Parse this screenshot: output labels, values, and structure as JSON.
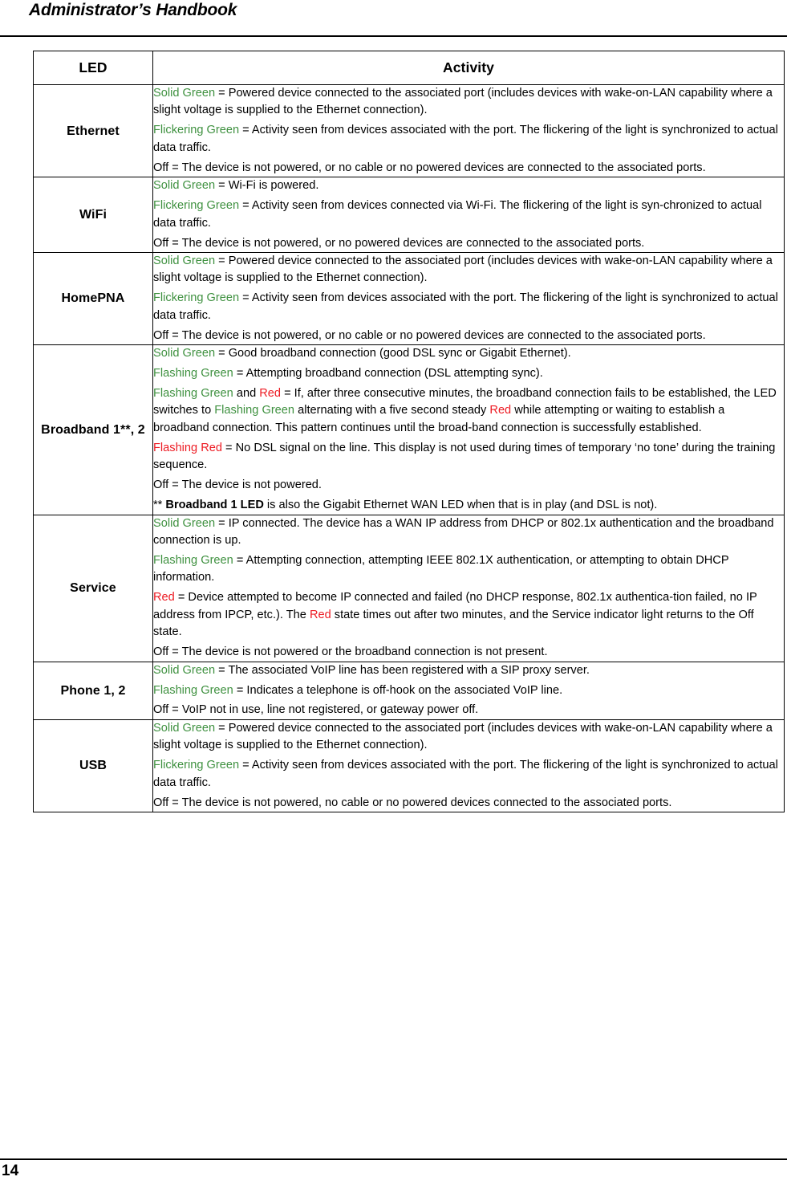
{
  "header": {
    "title": "Administrator’s Handbook"
  },
  "footer": {
    "page_number": "14"
  },
  "colors": {
    "green": "#3f9140",
    "red": "#ed1b23",
    "text": "#000000",
    "rule": "#000000",
    "background": "#ffffff"
  },
  "table": {
    "columns": [
      {
        "key": "led",
        "label": "LED"
      },
      {
        "key": "activity",
        "label": "Activity"
      }
    ],
    "rows": [
      {
        "led": "Ethernet",
        "paragraphs": [
          [
            {
              "t": "Solid Green",
              "c": "green"
            },
            {
              "t": " = Powered device connected to the associated port (includes devices with wake-on-LAN capability where a slight voltage is supplied to the Ethernet connection)."
            }
          ],
          [
            {
              "t": "Flickering Green",
              "c": "green"
            },
            {
              "t": " = Activity seen from devices associated with the port. The flickering of the light is synchronized to actual data traffic."
            }
          ],
          [
            {
              "t": "Off = The device is not powered, or no cable or no powered devices are connected to the associated ports."
            }
          ]
        ]
      },
      {
        "led": "WiFi",
        "paragraphs": [
          [
            {
              "t": "Solid Green",
              "c": "green"
            },
            {
              "t": " = Wi-Fi is powered."
            }
          ],
          [
            {
              "t": "Flickering Green",
              "c": "green"
            },
            {
              "t": " = Activity seen from devices connected via Wi-Fi. The flickering of the light is syn-chronized to actual data traffic."
            }
          ],
          [
            {
              "t": "Off = The device is not powered, or no powered devices are connected to the associated ports."
            }
          ]
        ]
      },
      {
        "led": "HomePNA",
        "paragraphs": [
          [
            {
              "t": "Solid Green",
              "c": "green"
            },
            {
              "t": " = Powered device connected to the associated port (includes devices with wake-on-LAN capability where a slight voltage is supplied to the Ethernet connection)."
            }
          ],
          [
            {
              "t": "Flickering Green",
              "c": "green"
            },
            {
              "t": " = Activity seen from devices associated with the port. The flickering of the light is synchronized to actual data traffic."
            }
          ],
          [
            {
              "t": "Off = The device is not powered, or no cable or no powered devices are connected to the associated ports."
            }
          ]
        ]
      },
      {
        "led": "Broadband 1**, 2",
        "paragraphs": [
          [
            {
              "t": "Solid Green",
              "c": "green"
            },
            {
              "t": " = Good broadband connection (good DSL sync or Gigabit Ethernet)."
            }
          ],
          [
            {
              "t": "Flashing Green",
              "c": "green"
            },
            {
              "t": " = Attempting broadband connection (DSL attempting sync)."
            }
          ],
          [
            {
              "t": "Flashing Green",
              "c": "green"
            },
            {
              "t": " and "
            },
            {
              "t": "Red",
              "c": "red"
            },
            {
              "t": " = If, after three consecutive minutes, the broadband connection fails to be established, the LED switches to "
            },
            {
              "t": "Flashing Green",
              "c": "green"
            },
            {
              "t": " alternating with a five second steady "
            },
            {
              "t": "Red",
              "c": "red"
            },
            {
              "t": " while attempting or waiting to establish a broadband connection. This pattern continues until the broad-band connection is successfully established."
            }
          ],
          [
            {
              "t": "Flashing Red",
              "c": "red"
            },
            {
              "t": " = No DSL signal on the line. This display is not used during times of temporary ‘no tone’ during the training sequence."
            }
          ],
          [
            {
              "t": "Off = The device is not powered."
            }
          ],
          [
            {
              "t": "** "
            },
            {
              "t": "Broadband 1 LED",
              "b": true
            },
            {
              "t": " is also the Gigabit Ethernet WAN LED when that is in play (and DSL is not)."
            }
          ]
        ]
      },
      {
        "led": "Service",
        "paragraphs": [
          [
            {
              "t": "Solid Green",
              "c": "green"
            },
            {
              "t": " = IP connected. The device has a WAN IP address from DHCP or 802.1x authentication and the broadband connection is up."
            }
          ],
          [
            {
              "t": "Flashing Green",
              "c": "green"
            },
            {
              "t": " = Attempting connection, attempting IEEE 802.1X authentication, or attempting to obtain DHCP information."
            }
          ],
          [
            {
              "t": "Red",
              "c": "red"
            },
            {
              "t": " = Device attempted to become IP connected and failed (no DHCP response, 802.1x authentica-tion failed, no IP address from IPCP, etc.). The "
            },
            {
              "t": "Red",
              "c": "red"
            },
            {
              "t": " state times out after two minutes, and the Service indicator light returns to the Off state."
            }
          ],
          [
            {
              "t": "Off = The device is not powered or the broadband connection is not present."
            }
          ]
        ]
      },
      {
        "led": "Phone 1, 2",
        "paragraphs": [
          [
            {
              "t": "Solid Green",
              "c": "green"
            },
            {
              "t": " = The associated VoIP line has been registered with a SIP proxy server."
            }
          ],
          [
            {
              "t": "Flashing Green",
              "c": "green"
            },
            {
              "t": " = Indicates a telephone is off-hook on the associated VoIP line."
            }
          ],
          [
            {
              "t": "Off = VoIP not in use, line not registered, or gateway power off."
            }
          ]
        ]
      },
      {
        "led": "USB",
        "paragraphs": [
          [
            {
              "t": "Solid Green",
              "c": "green"
            },
            {
              "t": " = Powered device connected to the associated port (includes devices with wake-on-LAN capability where a slight voltage is supplied to the Ethernet connection)."
            }
          ],
          [
            {
              "t": "Flickering Green",
              "c": "green"
            },
            {
              "t": " = Activity seen from devices associated with the port. The flickering of the light is synchronized to actual data traffic."
            }
          ],
          [
            {
              "t": "Off = The device is not powered, no cable or no powered devices connected to the associated ports."
            }
          ]
        ]
      }
    ]
  }
}
